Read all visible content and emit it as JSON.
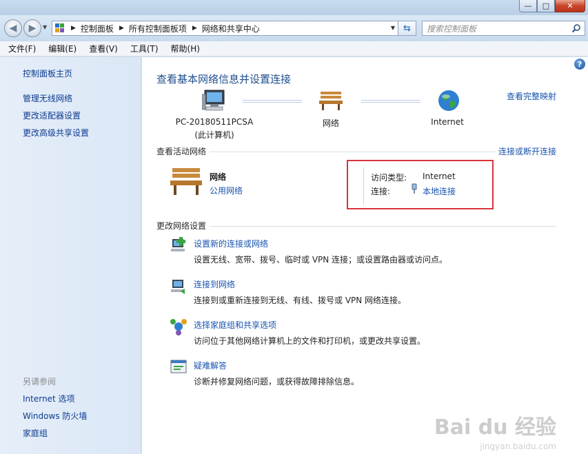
{
  "window": {
    "minimize": "—",
    "maximize": "□",
    "close": "✕"
  },
  "addressbar": {
    "crumbs": [
      "控制面板",
      "所有控制面板项",
      "网络和共享中心"
    ],
    "search_placeholder": "搜索控制面板"
  },
  "menu": [
    "文件(F)",
    "编辑(E)",
    "查看(V)",
    "工具(T)",
    "帮助(H)"
  ],
  "sidebar": {
    "home": "控制面板主页",
    "links": [
      "管理无线网络",
      "更改适配器设置",
      "更改高级共享设置"
    ],
    "see_also_header": "另请参阅",
    "see_also": [
      "Internet 选项",
      "Windows 防火墙",
      "家庭组"
    ]
  },
  "main": {
    "title": "查看基本网络信息并设置连接",
    "full_map_link": "查看完整映射",
    "map": {
      "computer_name": "PC-20180511PCSA",
      "computer_sub": "(此计算机)",
      "network": "网络",
      "internet": "Internet"
    },
    "active_header": "查看活动网络",
    "connect_link": "连接或断开连接",
    "active_network": {
      "name": "网络",
      "type_link": "公用网络",
      "access_label": "访问类型:",
      "access_value": "Internet",
      "connection_label": "连接:",
      "connection_link": "本地连接"
    },
    "change_header": "更改网络设置",
    "tasks": [
      {
        "link": "设置新的连接或网络",
        "desc": "设置无线、宽带、拨号、临时或 VPN 连接；或设置路由器或访问点。"
      },
      {
        "link": "连接到网络",
        "desc": "连接到或重新连接到无线、有线、拨号或 VPN 网络连接。"
      },
      {
        "link": "选择家庭组和共享选项",
        "desc": "访问位于其他网络计算机上的文件和打印机，或更改共享设置。"
      },
      {
        "link": "疑难解答",
        "desc": "诊断并修复网络问题，或获得故障排除信息。"
      }
    ]
  },
  "watermark": {
    "brand": "Bai du 经验",
    "url": "jingyan.baidu.com"
  },
  "colors": {
    "link": "#1754ae",
    "title": "#1e4e8f",
    "highlight_box": "#d8323c"
  }
}
